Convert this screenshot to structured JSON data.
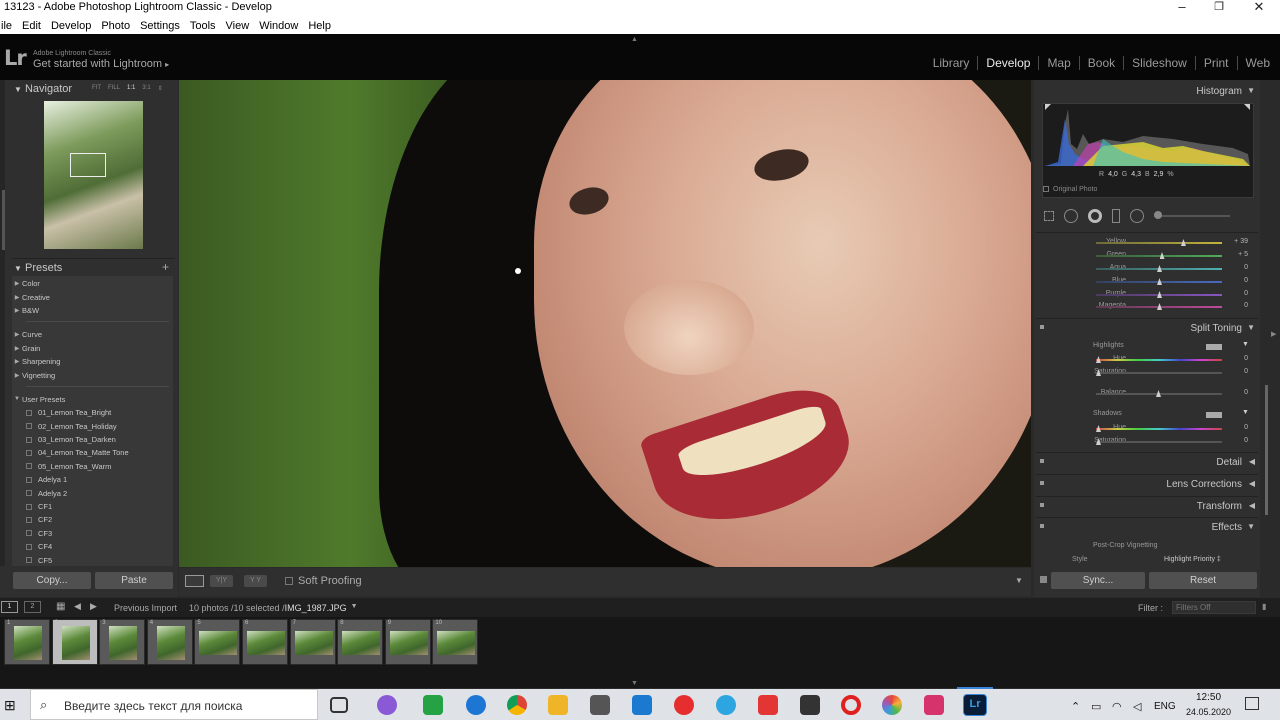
{
  "window": {
    "title": "13123 - Adobe Photoshop Lightroom Classic - Develop",
    "minimize": "–",
    "maximize": "❐",
    "close": "✕"
  },
  "menu": [
    "ile",
    "Edit",
    "Develop",
    "Photo",
    "Settings",
    "Tools",
    "View",
    "Window",
    "Help"
  ],
  "identity": {
    "logo": "Lr",
    "small": "Adobe Lightroom Classic",
    "main": "Get started with Lightroom",
    "arrow": "▸"
  },
  "modules": [
    "Library",
    "Develop",
    "Map",
    "Book",
    "Slideshow",
    "Print",
    "Web"
  ],
  "active_module": "Develop",
  "navigator": {
    "title": "Navigator",
    "zoom": [
      "FIT",
      "FILL",
      "1:1",
      "3:1"
    ]
  },
  "presets": {
    "title": "Presets",
    "groups1": [
      "Color",
      "Creative",
      "B&W"
    ],
    "groups2": [
      "Curve",
      "Grain",
      "Sharpening",
      "Vignetting"
    ],
    "user_title": "User Presets",
    "user_items": [
      "01_Lemon Tea_Bright",
      "02_Lemon Tea_Holiday",
      "03_Lemon Tea_Darken",
      "04_Lemon Tea_Matte Tone",
      "05_Lemon Tea_Warm",
      "Adelya 1",
      "Adelya 2",
      "CF1",
      "CF2",
      "CF3",
      "CF4",
      "CF5"
    ]
  },
  "left_buttons": {
    "copy": "Copy...",
    "paste": "Paste"
  },
  "toolbar": {
    "soft_proofing": "Soft Proofing"
  },
  "histogram": {
    "title": "Histogram",
    "readout": {
      "r_label": "R",
      "r": "4,0",
      "g_label": "G",
      "g": "4,3",
      "b_label": "B",
      "b": "2,9",
      "unit": "%"
    },
    "original_photo": "Original Photo"
  },
  "hsl_rows": [
    {
      "label": "Yellow",
      "value": "+ 39",
      "pos": 0.69,
      "colors": "#6d6a3a,#c2b33e"
    },
    {
      "label": "Green",
      "value": "+ 5",
      "pos": 0.52,
      "colors": "#3b5c3a,#4fae5b"
    },
    {
      "label": "Aqua",
      "value": "0",
      "pos": 0.5,
      "colors": "#3b5c5c,#4fb0b0"
    },
    {
      "label": "Blue",
      "value": "0",
      "pos": 0.5,
      "colors": "#33415c,#4a6ac0"
    },
    {
      "label": "Purple",
      "value": "0",
      "pos": 0.5,
      "colors": "#4a3a5c,#8a55c0"
    },
    {
      "label": "Magenta",
      "value": "0",
      "pos": 0.5,
      "colors": "#5c3a4f,#c04a9a"
    }
  ],
  "split_toning": {
    "title": "Split Toning",
    "highlights": "Highlights",
    "shadows": "Shadows",
    "hue_label": "Hue",
    "saturation_label": "Saturation",
    "balance_label": "Balance",
    "hue_value": "0",
    "saturation_value": "0",
    "balance_value": "0"
  },
  "sections": [
    "Detail",
    "Lens Corrections",
    "Transform",
    "Effects"
  ],
  "effects": {
    "vignetting": "Post-Crop Vignetting",
    "style_label": "Style",
    "style_value": "Highlight Priority ‡"
  },
  "right_buttons": {
    "sync": "Sync...",
    "reset": "Reset"
  },
  "filmstrip": {
    "source": "Previous Import",
    "info": "10 photos /10 selected /",
    "file": "IMG_1987.JPG",
    "filter_label": "Filter :",
    "filter_value": "Filters Off",
    "view1": "1",
    "view2": "2",
    "thumbs": [
      "1",
      "2",
      "3",
      "4",
      "5",
      "6",
      "7",
      "8",
      "9",
      "10"
    ]
  },
  "taskbar": {
    "search_placeholder": "Введите здесь текст для поиска",
    "lang": "ENG",
    "time": "12:50",
    "date": "24.05.2020"
  }
}
